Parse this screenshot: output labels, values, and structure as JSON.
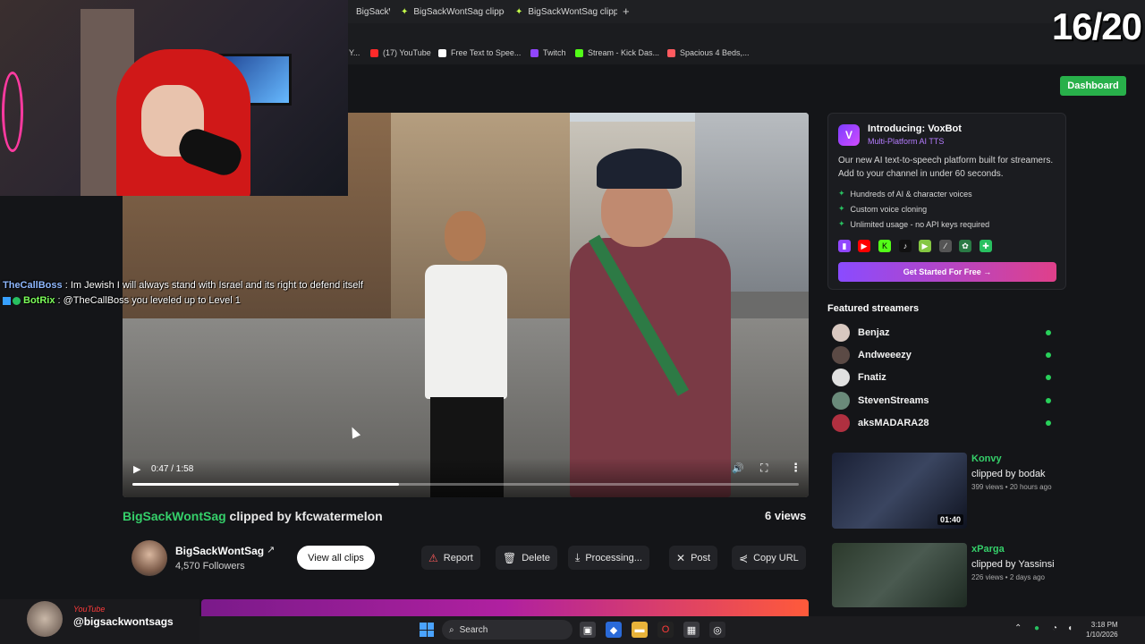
{
  "browser": {
    "tabs": [
      {
        "label": "BigSackWontSag clipped"
      },
      {
        "label": "BigSackWontSag clipped"
      },
      {
        "label": "BigSackWontSag clipped"
      }
    ],
    "bookmarks": [
      {
        "label": "Y...",
        "color": "#c8ff44"
      },
      {
        "label": "(17) YouTube",
        "color": "#ff2a2a"
      },
      {
        "label": "Free Text to Spee...",
        "color": "#ffffff"
      },
      {
        "label": "Twitch",
        "color": "#9146ff"
      },
      {
        "label": "Stream - Kick Das...",
        "color": "#53fc18"
      },
      {
        "label": "Spacious 4 Beds,...",
        "color": "#ff5a5f"
      }
    ]
  },
  "overlay": {
    "counter": "16/20",
    "chat": [
      {
        "user": "TheCallBoss",
        "message": ": Im Jewish I will always stand with Israel and its right to defend itself"
      },
      {
        "user": "BotRix",
        "message": ": @TheCallBoss you leveled up to Level 1"
      }
    ],
    "social_label": "YouTube",
    "social_handle": "@bigsackwontsags"
  },
  "header": {
    "dashboard_label": "Dashboard"
  },
  "video": {
    "current_time": "0:47",
    "duration": "1:58",
    "time_display": "0:47 / 1:58",
    "progress": 0.4
  },
  "clip": {
    "streamer": "BigSackWontSag",
    "clipped_by": "clipped by kfcwatermelon",
    "views": "6 views",
    "channel_name": "BigSackWontSag",
    "followers": "4,570 Followers",
    "view_all_label": "View all clips",
    "actions": {
      "report": "Report",
      "delete": "Delete",
      "download": "Processing...",
      "post": "Post",
      "copy": "Copy URL"
    }
  },
  "promo": {
    "title": "Introducing: VoxBot",
    "subtitle": "Multi-Platform AI TTS",
    "description": "Our new AI text-to-speech platform built for streamers. Add to your channel in under 60 seconds.",
    "features": [
      "Hundreds of AI & character voices",
      "Custom voice cloning",
      "Unlimited usage - no API keys required"
    ],
    "platforms": [
      {
        "name": "twitch-icon",
        "color": "#9146ff"
      },
      {
        "name": "youtube-icon",
        "color": "#ff0000"
      },
      {
        "name": "kick-icon",
        "color": "#53fc18"
      },
      {
        "name": "tiktok-icon",
        "color": "#ffffff"
      },
      {
        "name": "rumble-icon",
        "color": "#85c742"
      },
      {
        "name": "link-icon",
        "color": "#cccccc"
      },
      {
        "name": "flame-icon",
        "color": "#4cd964"
      },
      {
        "name": "puzzle-icon",
        "color": "#28c060"
      }
    ],
    "cta": "Get Started For Free →"
  },
  "featured": {
    "heading": "Featured streamers",
    "streamers": [
      {
        "name": "Benjaz"
      },
      {
        "name": "Andweeezy"
      },
      {
        "name": "Fnatiz"
      },
      {
        "name": "StevenStreams"
      },
      {
        "name": "aksMADARA28"
      }
    ]
  },
  "related_clips": [
    {
      "streamer": "Konvy",
      "by": "clipped by bodak",
      "meta": "399 views • 20 hours ago",
      "duration": "01:40"
    },
    {
      "streamer": "xParga",
      "by": "clipped by Yassinsi",
      "meta": "226 views • 2 days ago",
      "duration": ""
    }
  ],
  "taskbar": {
    "search": "Search",
    "time": "3:18 PM",
    "date": "1/10/2026"
  },
  "colors": {
    "accent_green": "#35d06a",
    "dashboard_green": "#28b04a"
  }
}
